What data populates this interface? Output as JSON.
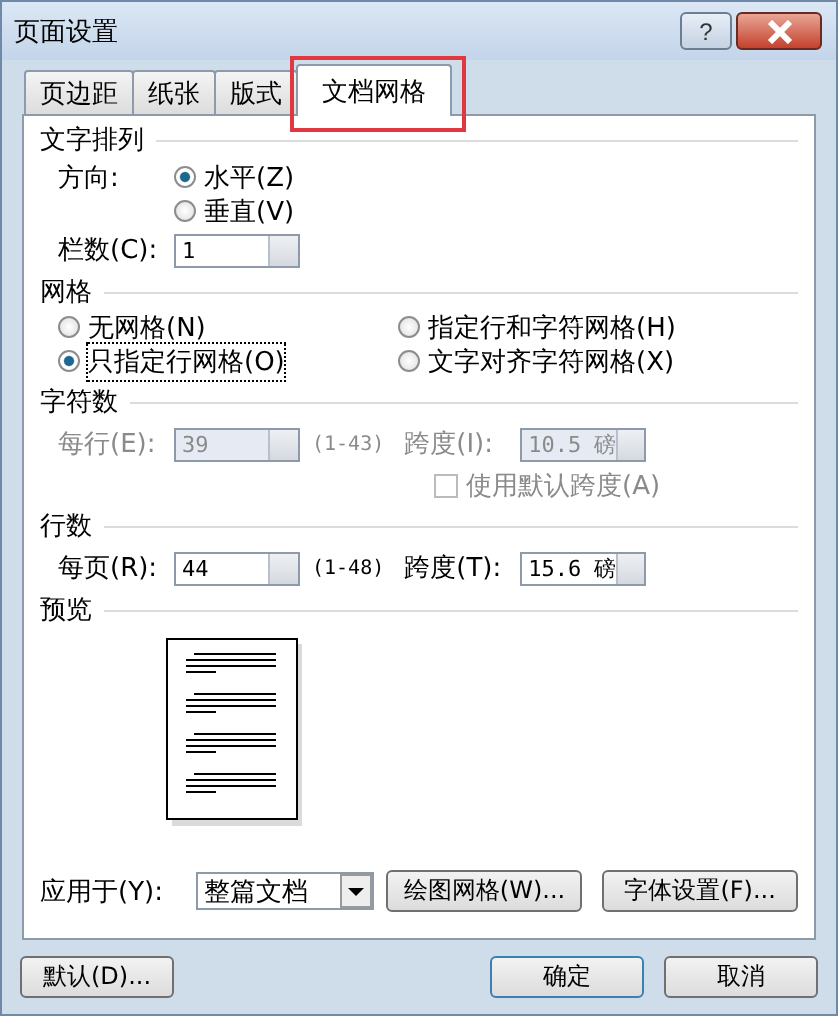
{
  "window": {
    "title": "页面设置",
    "help": "?"
  },
  "tabs": [
    {
      "label": "页边距",
      "selected": false,
      "highlighted": false
    },
    {
      "label": "纸张",
      "selected": false,
      "highlighted": false
    },
    {
      "label": "版式",
      "selected": false,
      "highlighted": false
    },
    {
      "label": "文档网格",
      "selected": true,
      "highlighted": true
    }
  ],
  "text_direction": {
    "heading": "文字排列",
    "direction_label": "方向:",
    "options": [
      {
        "label": "水平(Z)",
        "selected": true
      },
      {
        "label": "垂直(V)",
        "selected": false
      }
    ],
    "columns_label": "栏数(C):",
    "columns_value": "1"
  },
  "grid": {
    "heading": "网格",
    "options": [
      {
        "label": "无网格(N)",
        "selected": false,
        "focused": false
      },
      {
        "label": "指定行和字符网格(H)",
        "selected": false,
        "focused": false
      },
      {
        "label": "只指定行网格(O)",
        "selected": true,
        "focused": true
      },
      {
        "label": "文字对齐字符网格(X)",
        "selected": false,
        "focused": false
      }
    ]
  },
  "characters": {
    "heading": "字符数",
    "disabled": true,
    "count_label": "每行(E):",
    "count_value": "39",
    "range": "(1-43)",
    "pitch_label": "跨度(I):",
    "pitch_value": "10.5 磅",
    "default_pitch": {
      "label": "使用默认跨度(A)",
      "checked": false
    }
  },
  "lines": {
    "heading": "行数",
    "disabled": false,
    "count_label": "每页(R):",
    "count_value": "44",
    "range": "(1-48)",
    "pitch_label": "跨度(T):",
    "pitch_value": "15.6 磅"
  },
  "preview": {
    "heading": "预览"
  },
  "apply": {
    "label": "应用于(Y):",
    "value": "整篇文档"
  },
  "panel_buttons": [
    "绘图网格(W)...",
    "字体设置(F)..."
  ],
  "footer": {
    "default": "默认(D)...",
    "ok": "确定",
    "cancel": "取消"
  }
}
